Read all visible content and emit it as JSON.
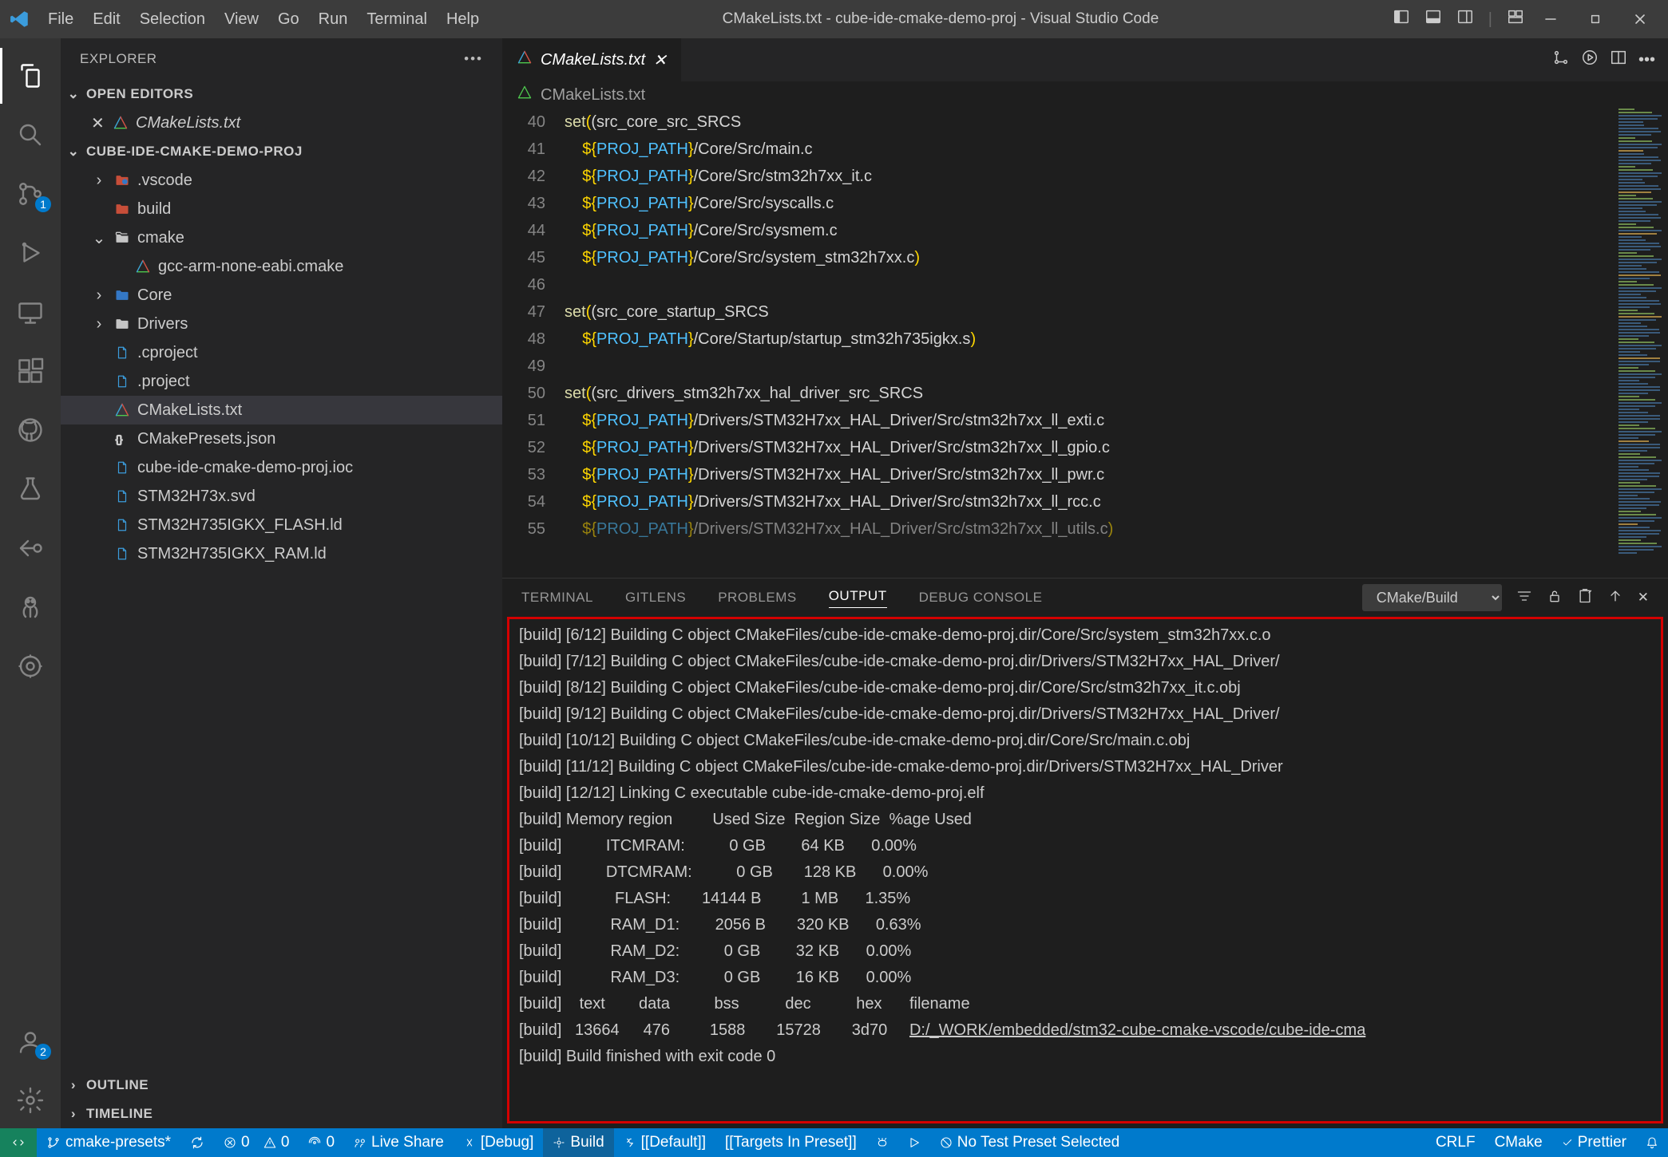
{
  "title": "CMakeLists.txt - cube-ide-cmake-demo-proj - Visual Studio Code",
  "menu": [
    "File",
    "Edit",
    "Selection",
    "View",
    "Go",
    "Run",
    "Terminal",
    "Help"
  ],
  "sidebar": {
    "title": "EXPLORER",
    "openEditors": "OPEN EDITORS",
    "openFile": "CMakeLists.txt",
    "project": "CUBE-IDE-CMAKE-DEMO-PROJ",
    "tree": [
      {
        "indent": 1,
        "chev": ">",
        "icon": "folder-vs",
        "label": ".vscode",
        "color": "#3478c6"
      },
      {
        "indent": 1,
        "chev": "",
        "icon": "folder-red",
        "label": "build",
        "color": "#c74e39"
      },
      {
        "indent": 1,
        "chev": "v",
        "icon": "folder-open",
        "label": "cmake",
        "color": "#c5c5c5"
      },
      {
        "indent": 2,
        "chev": "",
        "icon": "cmake",
        "label": "gcc-arm-none-eabi.cmake"
      },
      {
        "indent": 1,
        "chev": ">",
        "icon": "folder-core",
        "label": "Core",
        "color": "#3478c6"
      },
      {
        "indent": 1,
        "chev": ">",
        "icon": "folder",
        "label": "Drivers",
        "color": "#c5c5c5"
      },
      {
        "indent": 1,
        "chev": "",
        "icon": "file",
        "label": ".cproject"
      },
      {
        "indent": 1,
        "chev": "",
        "icon": "file",
        "label": ".project"
      },
      {
        "indent": 1,
        "chev": "",
        "icon": "cmake",
        "label": "CMakeLists.txt",
        "selected": true
      },
      {
        "indent": 1,
        "chev": "",
        "icon": "json",
        "label": "CMakePresets.json"
      },
      {
        "indent": 1,
        "chev": "",
        "icon": "file",
        "label": "cube-ide-cmake-demo-proj.ioc"
      },
      {
        "indent": 1,
        "chev": "",
        "icon": "file",
        "label": "STM32H73x.svd"
      },
      {
        "indent": 1,
        "chev": "",
        "icon": "file",
        "label": "STM32H735IGKX_FLASH.ld"
      },
      {
        "indent": 1,
        "chev": "",
        "icon": "file",
        "label": "STM32H735IGKX_RAM.ld"
      }
    ],
    "outline": "OUTLINE",
    "timeline": "TIMELINE"
  },
  "tab": {
    "label": "CMakeLists.txt"
  },
  "breadcrumb": "CMakeLists.txt",
  "code": {
    "start": 40,
    "lines": [
      {
        "t": "set",
        "a": "(src_core_src_SRCS"
      },
      {
        "v": "${PROJ_PATH}",
        "r": "/Core/Src/main.c"
      },
      {
        "v": "${PROJ_PATH}",
        "r": "/Core/Src/stm32h7xx_it.c"
      },
      {
        "v": "${PROJ_PATH}",
        "r": "/Core/Src/syscalls.c"
      },
      {
        "v": "${PROJ_PATH}",
        "r": "/Core/Src/sysmem.c"
      },
      {
        "v": "${PROJ_PATH}",
        "r": "/Core/Src/system_stm32h7xx.c",
        "close": ")"
      },
      {
        "blank": true
      },
      {
        "t": "set",
        "a": "(src_core_startup_SRCS"
      },
      {
        "v": "${PROJ_PATH}",
        "r": "/Core/Startup/startup_stm32h735igkx.s",
        "close": ")"
      },
      {
        "blank": true
      },
      {
        "t": "set",
        "a": "(src_drivers_stm32h7xx_hal_driver_src_SRCS"
      },
      {
        "v": "${PROJ_PATH}",
        "r": "/Drivers/STM32H7xx_HAL_Driver/Src/stm32h7xx_ll_exti.c"
      },
      {
        "v": "${PROJ_PATH}",
        "r": "/Drivers/STM32H7xx_HAL_Driver/Src/stm32h7xx_ll_gpio.c"
      },
      {
        "v": "${PROJ_PATH}",
        "r": "/Drivers/STM32H7xx_HAL_Driver/Src/stm32h7xx_ll_pwr.c"
      },
      {
        "v": "${PROJ_PATH}",
        "r": "/Drivers/STM32H7xx_HAL_Driver/Src/stm32h7xx_ll_rcc.c"
      },
      {
        "v": "${PROJ_PATH}",
        "r": "/Drivers/STM32H7xx_HAL_Driver/Src/stm32h7xx_ll_utils.c",
        "close": ")",
        "dim": true
      }
    ]
  },
  "panel": {
    "tabs": [
      "TERMINAL",
      "GITLENS",
      "PROBLEMS",
      "OUTPUT",
      "DEBUG CONSOLE"
    ],
    "active": "OUTPUT",
    "select": "CMake/Build",
    "lines": [
      "[build] [6/12] Building C object CMakeFiles/cube-ide-cmake-demo-proj.dir/Core/Src/system_stm32h7xx.c.o",
      "[build] [7/12] Building C object CMakeFiles/cube-ide-cmake-demo-proj.dir/Drivers/STM32H7xx_HAL_Driver/",
      "[build] [8/12] Building C object CMakeFiles/cube-ide-cmake-demo-proj.dir/Core/Src/stm32h7xx_it.c.obj",
      "[build] [9/12] Building C object CMakeFiles/cube-ide-cmake-demo-proj.dir/Drivers/STM32H7xx_HAL_Driver/",
      "[build] [10/12] Building C object CMakeFiles/cube-ide-cmake-demo-proj.dir/Core/Src/main.c.obj",
      "[build] [11/12] Building C object CMakeFiles/cube-ide-cmake-demo-proj.dir/Drivers/STM32H7xx_HAL_Driver",
      "[build] [12/12] Linking C executable cube-ide-cmake-demo-proj.elf",
      "[build] Memory region         Used Size  Region Size  %age Used",
      "[build]          ITCMRAM:          0 GB        64 KB      0.00%",
      "[build]          DTCMRAM:          0 GB       128 KB      0.00%",
      "[build]            FLASH:       14144 B         1 MB      1.35%",
      "[build]           RAM_D1:        2056 B       320 KB      0.63%",
      "[build]           RAM_D2:          0 GB        32 KB      0.00%",
      "[build]           RAM_D3:          0 GB        16 KB      0.00%",
      "[build]    text\t   data\t    bss\t    dec\t    hex\tfilename",
      "[build]   13664\t    476\t   1588\t  15728\t   3d70\t",
      "[build] Build finished with exit code 0",
      ""
    ],
    "elfPath": "D:/_WORK/embedded/stm32-cube-cmake-vscode/cube-ide-cma"
  },
  "statusbar": {
    "branch": "cmake-presets*",
    "sync": "↻",
    "errors": "0",
    "warnings": "0",
    "ports": "0",
    "liveshare": "Live Share",
    "debug": "[Debug]",
    "build": "Build",
    "default": "[[Default]]",
    "targets": "[[Targets In Preset]]",
    "launch": "",
    "launchPlay": "",
    "notest": "No Test Preset Selected",
    "eol": "CRLF",
    "lang": "CMake",
    "prettier": "Prettier"
  }
}
